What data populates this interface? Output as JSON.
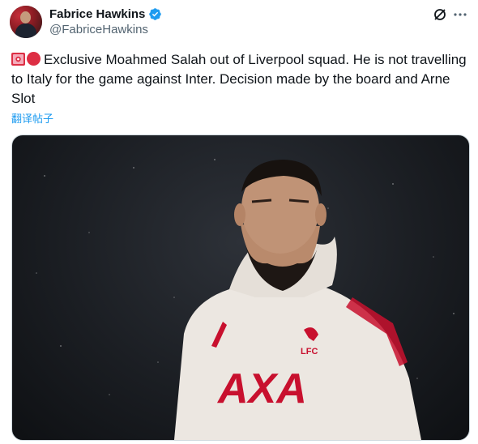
{
  "author": {
    "display_name": "Fabrice Hawkins",
    "handle": "@FabriceHawkins",
    "verified": true
  },
  "post": {
    "text": "Exclusive Moahmed Salah out of Liverpool squad. He is not travelling to Italy for the game against Inter. Decision made by the board and Arne Slot",
    "translate_label": "翻译帖子",
    "leading_emojis": [
      "siren-emoji",
      "red-circle-emoji"
    ]
  },
  "media": {
    "kit_logo_text": "LFC",
    "sponsor_text": "AXA"
  },
  "colors": {
    "link": "#1d9bf0",
    "verified": "#1d9bf0",
    "text_primary": "#0f1419",
    "text_secondary": "#536471",
    "kit_red": "#c8102e"
  },
  "icons": {
    "grok": "grok-icon",
    "more": "more-icon"
  }
}
